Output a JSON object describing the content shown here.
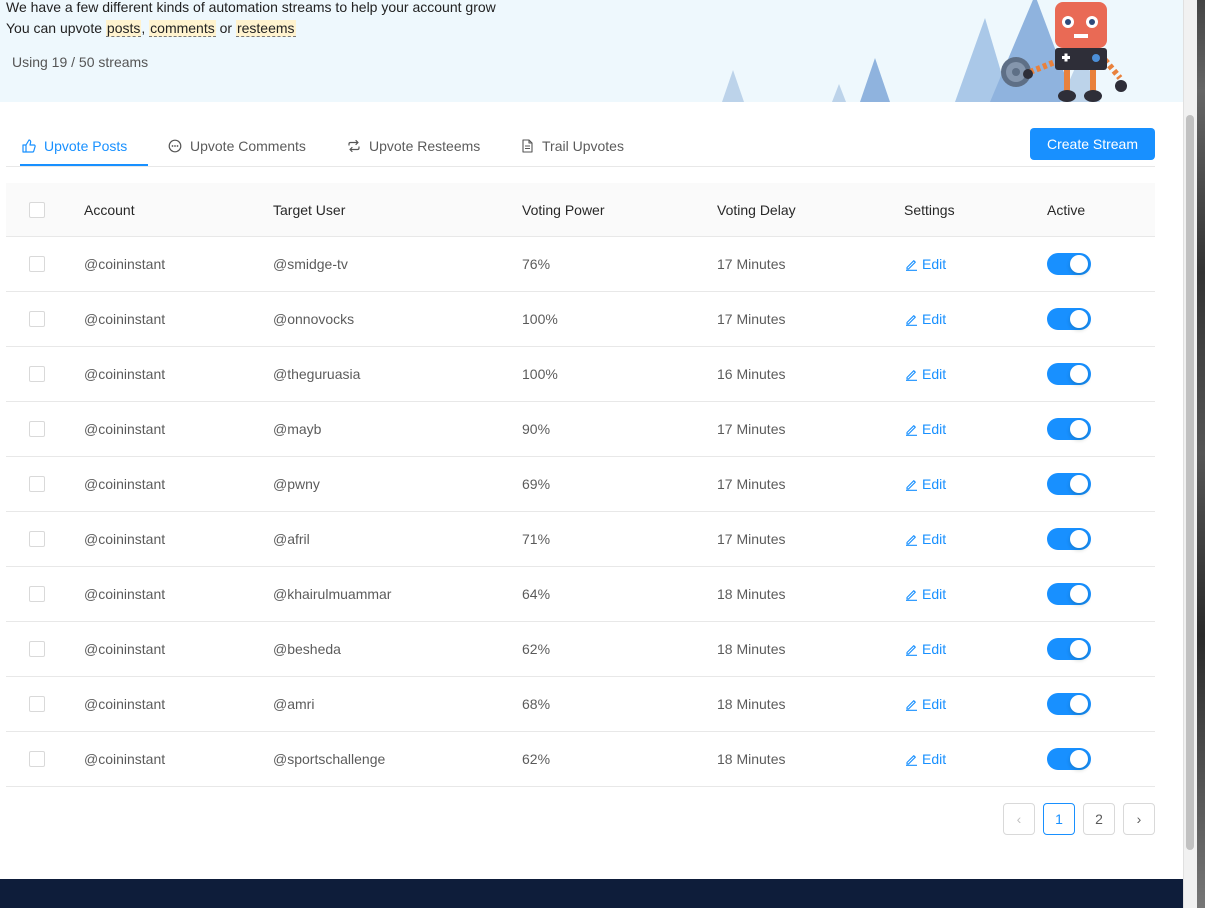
{
  "banner": {
    "line1": "We have a few different kinds of automation streams to help your account grow",
    "line2_prefix": "You can upvote ",
    "kw_posts": "posts",
    "sep1": ", ",
    "kw_comments": "comments",
    "sep2": " or ",
    "kw_resteems": "resteems",
    "usage": "Using 19 / 50 streams"
  },
  "tabs": [
    {
      "label": "Upvote Posts",
      "icon": "thumbs-up-icon",
      "active": true
    },
    {
      "label": "Upvote Comments",
      "icon": "comment-icon",
      "active": false
    },
    {
      "label": "Upvote Resteems",
      "icon": "retweet-icon",
      "active": false
    },
    {
      "label": "Trail Upvotes",
      "icon": "file-icon",
      "active": false
    }
  ],
  "create_button": "Create Stream",
  "table": {
    "headers": {
      "account": "Account",
      "target": "Target User",
      "power": "Voting Power",
      "delay": "Voting Delay",
      "settings": "Settings",
      "active": "Active"
    },
    "edit_label": "Edit",
    "rows": [
      {
        "account": "@coininstant",
        "target": "@smidge-tv",
        "power": "76%",
        "delay": "17 Minutes",
        "active": true
      },
      {
        "account": "@coininstant",
        "target": "@onnovocks",
        "power": "100%",
        "delay": "17 Minutes",
        "active": true
      },
      {
        "account": "@coininstant",
        "target": "@theguruasia",
        "power": "100%",
        "delay": "16 Minutes",
        "active": true
      },
      {
        "account": "@coininstant",
        "target": "@mayb",
        "power": "90%",
        "delay": "17 Minutes",
        "active": true
      },
      {
        "account": "@coininstant",
        "target": "@pwny",
        "power": "69%",
        "delay": "17 Minutes",
        "active": true
      },
      {
        "account": "@coininstant",
        "target": "@afril",
        "power": "71%",
        "delay": "17 Minutes",
        "active": true
      },
      {
        "account": "@coininstant",
        "target": "@khairulmuammar",
        "power": "64%",
        "delay": "18 Minutes",
        "active": true
      },
      {
        "account": "@coininstant",
        "target": "@besheda",
        "power": "62%",
        "delay": "18 Minutes",
        "active": true
      },
      {
        "account": "@coininstant",
        "target": "@amri",
        "power": "68%",
        "delay": "18 Minutes",
        "active": true
      },
      {
        "account": "@coininstant",
        "target": "@sportschallenge",
        "power": "62%",
        "delay": "18 Minutes",
        "active": true
      }
    ]
  },
  "pagination": {
    "prev": "‹",
    "pages": [
      "1",
      "2"
    ],
    "current": "1",
    "next": "›"
  },
  "colors": {
    "primary": "#1890ff",
    "banner_bg": "#eef8fd",
    "footer_bg": "#0e1d3a"
  }
}
